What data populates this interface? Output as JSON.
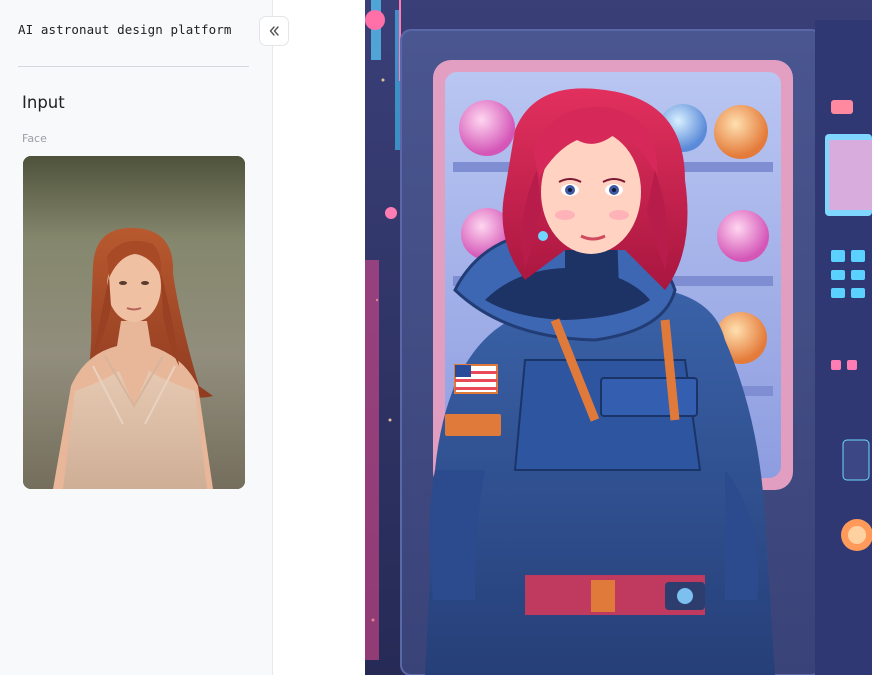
{
  "app": {
    "title": "AI astronaut design platform"
  },
  "sidebar": {
    "section_title": "Input",
    "face_label": "Face",
    "collapse_icon": "double-chevron-left-icon"
  },
  "colors": {
    "sidebar_bg": "#f8f9fb",
    "hair": "#d4234f",
    "suit": "#2f4f8f",
    "neon_pink": "#ff6fa8"
  }
}
